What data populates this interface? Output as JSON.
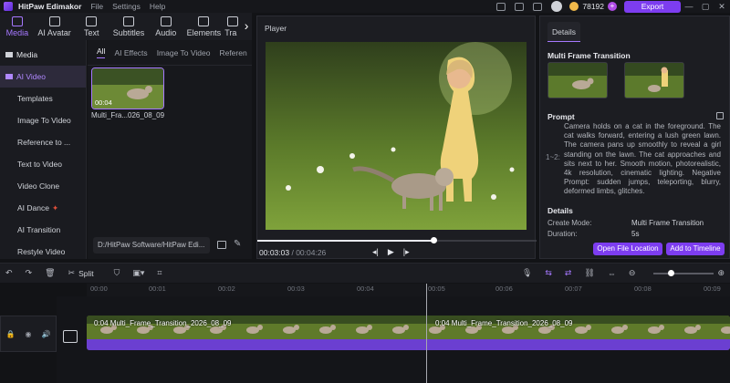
{
  "titlebar": {
    "app_name": "HitPaw Edimakor",
    "menu": [
      "File",
      "Settings",
      "Help"
    ],
    "credits": "78192",
    "export_label": "Export"
  },
  "toolbar": {
    "tabs": [
      {
        "label": "Media",
        "icon": "media-icon",
        "active": true
      },
      {
        "label": "AI Avatar",
        "icon": "avatar-icon"
      },
      {
        "label": "Text",
        "icon": "text-icon"
      },
      {
        "label": "Subtitles",
        "icon": "subtitles-icon"
      },
      {
        "label": "Audio",
        "icon": "audio-icon"
      },
      {
        "label": "Elements",
        "icon": "elements-icon"
      },
      {
        "label": "Tra",
        "icon": "transition-icon"
      }
    ]
  },
  "sidebar": {
    "items": [
      {
        "label": "Media",
        "group": true
      },
      {
        "label": "AI Video",
        "group": true,
        "active": true
      },
      {
        "label": "Templates"
      },
      {
        "label": "Image To Video"
      },
      {
        "label": "Reference to ..."
      },
      {
        "label": "Text to Video"
      },
      {
        "label": "Video Clone"
      },
      {
        "label": "AI Dance"
      },
      {
        "label": "AI Transition"
      },
      {
        "label": "Restyle Video"
      }
    ]
  },
  "media_panel": {
    "tabs": [
      "All",
      "AI Effects",
      "Image To Video",
      "Referen"
    ],
    "thumbnail": {
      "duration": "00:04",
      "name": "Multi_Fra...026_08_09"
    },
    "path": "D:/HitPaw Software/HitPaw Edi..."
  },
  "player": {
    "label": "Player",
    "current_time": "00:03:03",
    "total_time": "/ 00:04:26",
    "progress": 0.63
  },
  "details": {
    "tab": "Details",
    "heading": "Multi Frame Transition",
    "prompt_label": "Prompt",
    "side_label": "1~2:",
    "prompt_text": "Camera holds on a cat in the foreground. The cat walks forward, entering a lush green lawn. The camera pans up smoothly to reveal a girl standing on the lawn. The cat approaches and sits next to her. Smooth motion, photorealistic, 4k resolution, cinematic lighting. Negative Prompt: sudden jumps, teleporting, blurry, deformed limbs, glitches.",
    "details_label": "Details",
    "create_mode_label": "Create Mode:",
    "create_mode_value": "Multi Frame Transition",
    "duration_label": "Duration:",
    "duration_value": "5s",
    "open_location": "Open File Location",
    "add_timeline": "Add to Timeline"
  },
  "timeline": {
    "split_label": "Split",
    "ticks": [
      "00:00",
      "00:01",
      "00:02",
      "00:03",
      "00:04",
      "00:05",
      "00:06",
      "00:07",
      "00:08",
      "00:09"
    ],
    "clip_labels": [
      "0:04 Multi_Frame_Transition_2026_08_09",
      "0:04 Multi_Frame_Transition_2026_08_09"
    ]
  }
}
